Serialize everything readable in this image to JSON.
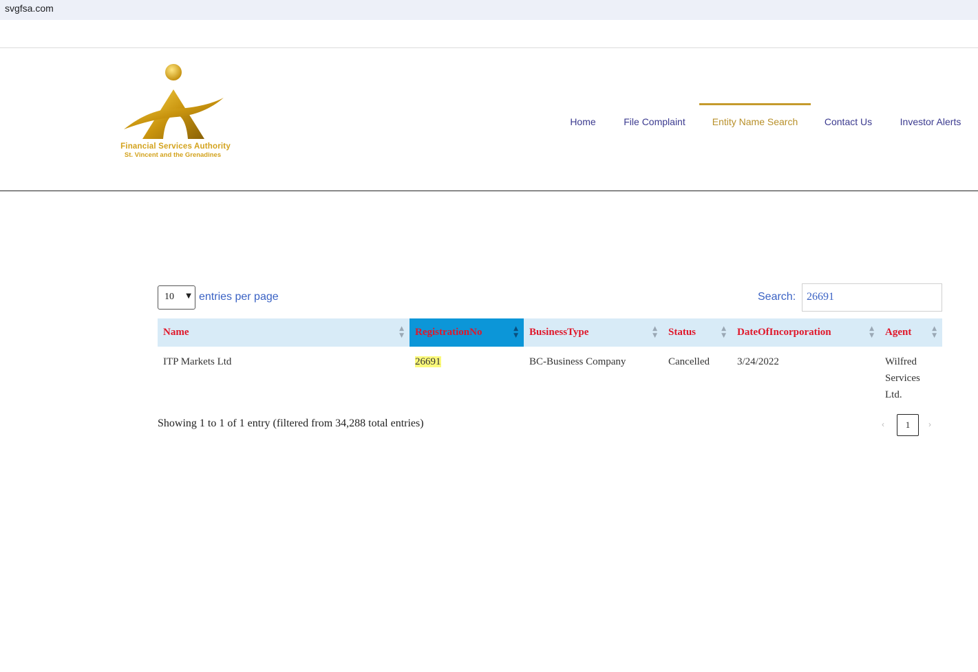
{
  "browser": {
    "url": "svgfsa.com"
  },
  "logo": {
    "line1": "Financial Services Authority",
    "line2": "St. Vincent and the Grenadines",
    "color": "#d3a21c"
  },
  "nav": {
    "items": [
      {
        "label": "Home"
      },
      {
        "label": "File Complaint"
      },
      {
        "label": "Entity Name Search",
        "active": true
      },
      {
        "label": "Contact Us"
      },
      {
        "label": "Investor Alerts"
      }
    ],
    "link_color": "#3b3a8f",
    "active_color": "#b8902a"
  },
  "table_controls": {
    "per_page_value": "10",
    "per_page_label": "entries per page",
    "search_label": "Search:",
    "search_value": "26691"
  },
  "table": {
    "columns": [
      {
        "label": "Name"
      },
      {
        "label": "RegistrationNo",
        "sorted": true
      },
      {
        "label": "BusinessType"
      },
      {
        "label": "Status"
      },
      {
        "label": "DateOfIncorporation"
      },
      {
        "label": "Agent"
      }
    ],
    "rows": [
      {
        "name": "ITP Markets Ltd",
        "registration_no": "26691",
        "business_type": "BC-Business Company",
        "status": "Cancelled",
        "date_of_incorporation": "3/24/2022",
        "agent_line1": "Wilfred",
        "agent_line2": "Services",
        "agent_line3": "Ltd."
      }
    ],
    "header_text_color": "#e0172a",
    "header_bg": "#d8ebf7",
    "sorted_bg": "#0c96d8"
  },
  "footer": {
    "info": "Showing 1 to 1 of 1 entry (filtered from 34,288 total entries)",
    "pagination": {
      "prev": "‹",
      "current_page": "1",
      "next": "›"
    }
  }
}
